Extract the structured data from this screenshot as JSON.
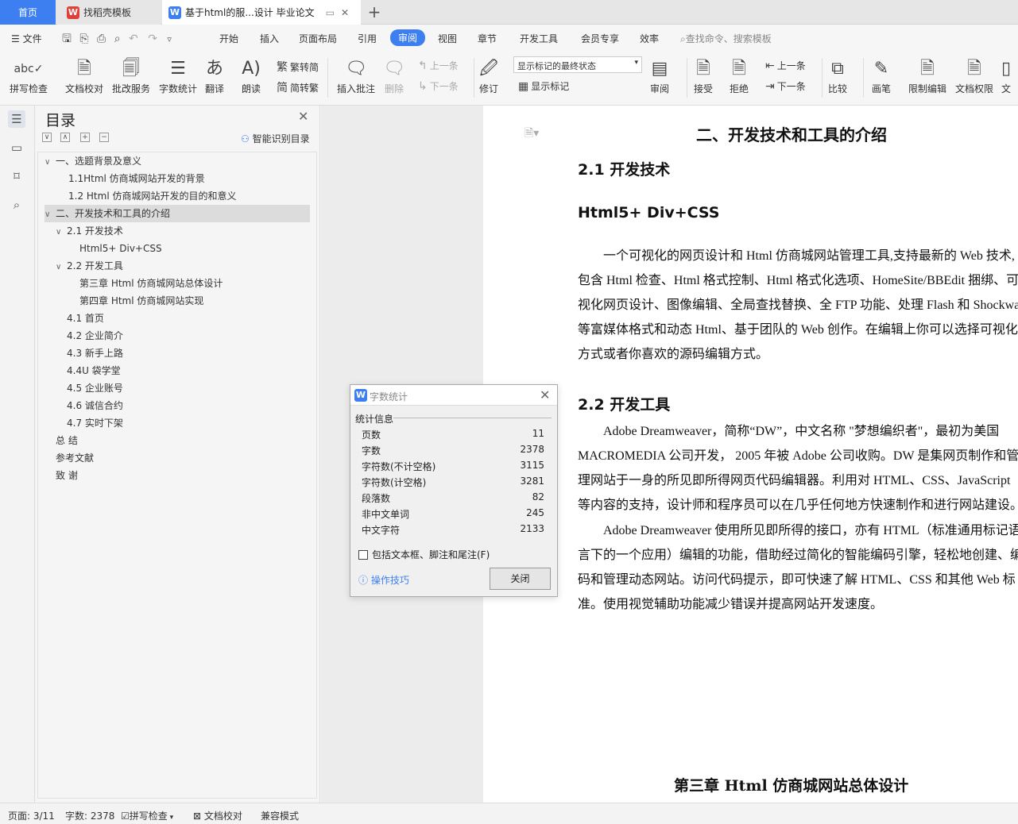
{
  "tabs": {
    "home": "首页",
    "templates": "找稻壳模板",
    "document": "基于html的服...设计 毕业论文"
  },
  "menu": {
    "file": "文件",
    "items": [
      "开始",
      "插入",
      "页面布局",
      "引用",
      "审阅",
      "视图",
      "章节",
      "开发工具",
      "会员专享",
      "效率"
    ],
    "search_placeholder": "查找命令、搜索模板"
  },
  "ribbon": {
    "spell_check": "拼写检查",
    "doc_proofread": "文档校对",
    "revise_service": "批改服务",
    "word_count": "字数统计",
    "translate": "翻译",
    "read_aloud": "朗读",
    "to_simplified": "繁转简",
    "to_traditional": "简转繁",
    "insert_comment": "插入批注",
    "delete": "删除",
    "prev": "上一条",
    "next": "下一条",
    "track_changes": "修订",
    "markup_state": "显示标记的最终状态",
    "show_markup": "显示标记",
    "review": "审阅",
    "accept": "接受",
    "reject": "拒绝",
    "prev2": "上一条",
    "next2": "下一条",
    "compare": "比较",
    "pen": "画笔",
    "restrict_edit": "限制编辑",
    "doc_permission": "文档权限",
    "doc_cut": "文"
  },
  "toc": {
    "title": "目录",
    "smart": "智能识别目录",
    "items": [
      {
        "text": "一、选题背景及意义",
        "arrow": "∨"
      },
      {
        "text": "1.1Html 仿商城网站开发的背景",
        "arrow": ""
      },
      {
        "text": "1.2 Html 仿商城网站开发的目的和意义",
        "arrow": ""
      },
      {
        "text": "二、开发技术和工具的介绍",
        "arrow": "∨"
      },
      {
        "text": "2.1 开发技术",
        "arrow": "∨"
      },
      {
        "text": "Html5+ Div+CSS",
        "arrow": ""
      },
      {
        "text": "2.2 开发工具",
        "arrow": "∨"
      },
      {
        "text": "第三章 Html 仿商城网站总体设计",
        "arrow": ""
      },
      {
        "text": "第四章 Html 仿商城网站实现",
        "arrow": ""
      },
      {
        "text": "4.1 首页",
        "arrow": ""
      },
      {
        "text": "4.2 企业简介",
        "arrow": ""
      },
      {
        "text": "4.3 新手上路",
        "arrow": ""
      },
      {
        "text": "4.4U 袋学堂",
        "arrow": ""
      },
      {
        "text": "4.5 企业账号",
        "arrow": ""
      },
      {
        "text": "4.6 诚信合约",
        "arrow": ""
      },
      {
        "text": "4.7 实时下架",
        "arrow": ""
      },
      {
        "text": "总 结",
        "arrow": ""
      },
      {
        "text": "参考文献",
        "arrow": ""
      },
      {
        "text": "致 谢",
        "arrow": ""
      }
    ]
  },
  "document": {
    "h1": "二、开发技术和工具的介绍",
    "h2_1": "2.1 开发技术",
    "h3": "Html5+ Div+CSS",
    "p1": [
      "一个可视化的网页设计和 Html 仿商城网站管理工具,支持最新的 Web 技术,",
      "包含 Html 检查、Html 格式控制、Html 格式化选项、HomeSite/BBEdit 捆绑、可",
      "视化网页设计、图像编辑、全局查找替换、全 FTP 功能、处理 Flash 和 Shockwave",
      "等富媒体格式和动态 Html、基于团队的 Web 创作。在编辑上你可以选择可视化",
      "方式或者你喜欢的源码编辑方式。"
    ],
    "h2_2": "2.2 开发工具",
    "p2": [
      "Adobe Dreamweaver，简称“DW”，中文名称 \"梦想编织者\"，最初为美国",
      "MACROMEDIA 公司开发， 2005 年被 Adobe 公司收购。DW 是集网页制作和管",
      "理网站于一身的所见即所得网页代码编辑器。利用对 HTML、CSS、JavaScript",
      "等内容的支持，设计师和程序员可以在几乎任何地方快速制作和进行网站建设。"
    ],
    "p3": [
      "Adobe Dreamweaver 使用所见即所得的接口，亦有 HTML（标准通用标记语",
      "言下的一个应用）编辑的功能，借助经过简化的智能编码引擎，轻松地创建、编",
      "码和管理动态网站。访问代码提示，即可快速了解 HTML、CSS 和其他 Web 标",
      "准。使用视觉辅助功能减少错误并提高网站开发速度。"
    ],
    "next_chapter": "第三章 Html 仿商城网站总体设计"
  },
  "dialog": {
    "title": "字数统计",
    "section": "统计信息",
    "rows": [
      {
        "label": "页数",
        "value": "11"
      },
      {
        "label": "字数",
        "value": "2378"
      },
      {
        "label": "字符数(不计空格)",
        "value": "3115"
      },
      {
        "label": "字符数(计空格)",
        "value": "3281"
      },
      {
        "label": "段落数",
        "value": "82"
      },
      {
        "label": "非中文单词",
        "value": "245"
      },
      {
        "label": "中文字符",
        "value": "2133"
      }
    ],
    "include_label": "包括文本框、脚注和尾注(F)",
    "tips": "操作技巧",
    "close": "关闭"
  },
  "status": {
    "page": "页面: 3/11",
    "words": "字数: 2378",
    "spell": "拼写检查",
    "proof": "文档校对",
    "compat": "兼容模式"
  },
  "colors": {
    "accent": "#3d7ff0",
    "wps_red": "#e0403a"
  }
}
